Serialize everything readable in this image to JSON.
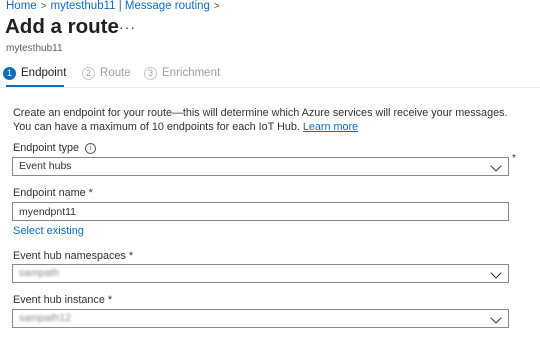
{
  "breadcrumb": {
    "items": [
      "Home",
      "mytesthub11 | Message routing"
    ],
    "separator": ">"
  },
  "header": {
    "title": "Add a route",
    "more_label": "···",
    "subtitle": "mytesthub11"
  },
  "steps": [
    {
      "number": "1",
      "label": "Endpoint",
      "state": "active"
    },
    {
      "number": "2",
      "label": "Route",
      "state": "inactive"
    },
    {
      "number": "3",
      "label": "Enrichment",
      "state": "inactive"
    }
  ],
  "description": {
    "text": "Create an endpoint for your route—this will determine which Azure services will receive your messages. You can have a maximum of 10 endpoints for each IoT Hub.",
    "link_label": "Learn more"
  },
  "form": {
    "endpoint_type": {
      "label": "Endpoint type",
      "value": "Event hubs",
      "required_mark": "*"
    },
    "endpoint_name": {
      "label": "Endpoint name *",
      "value": "myendpnt11"
    },
    "select_existing": "Select existing",
    "event_hub_namespaces": {
      "label": "Event hub namespaces *",
      "value": "sampath"
    },
    "event_hub_instance": {
      "label": "Event hub instance *",
      "value": "sampath12"
    }
  },
  "colors": {
    "accent": "#0f6cbd",
    "text": "#323130",
    "border": "#8a8886"
  }
}
